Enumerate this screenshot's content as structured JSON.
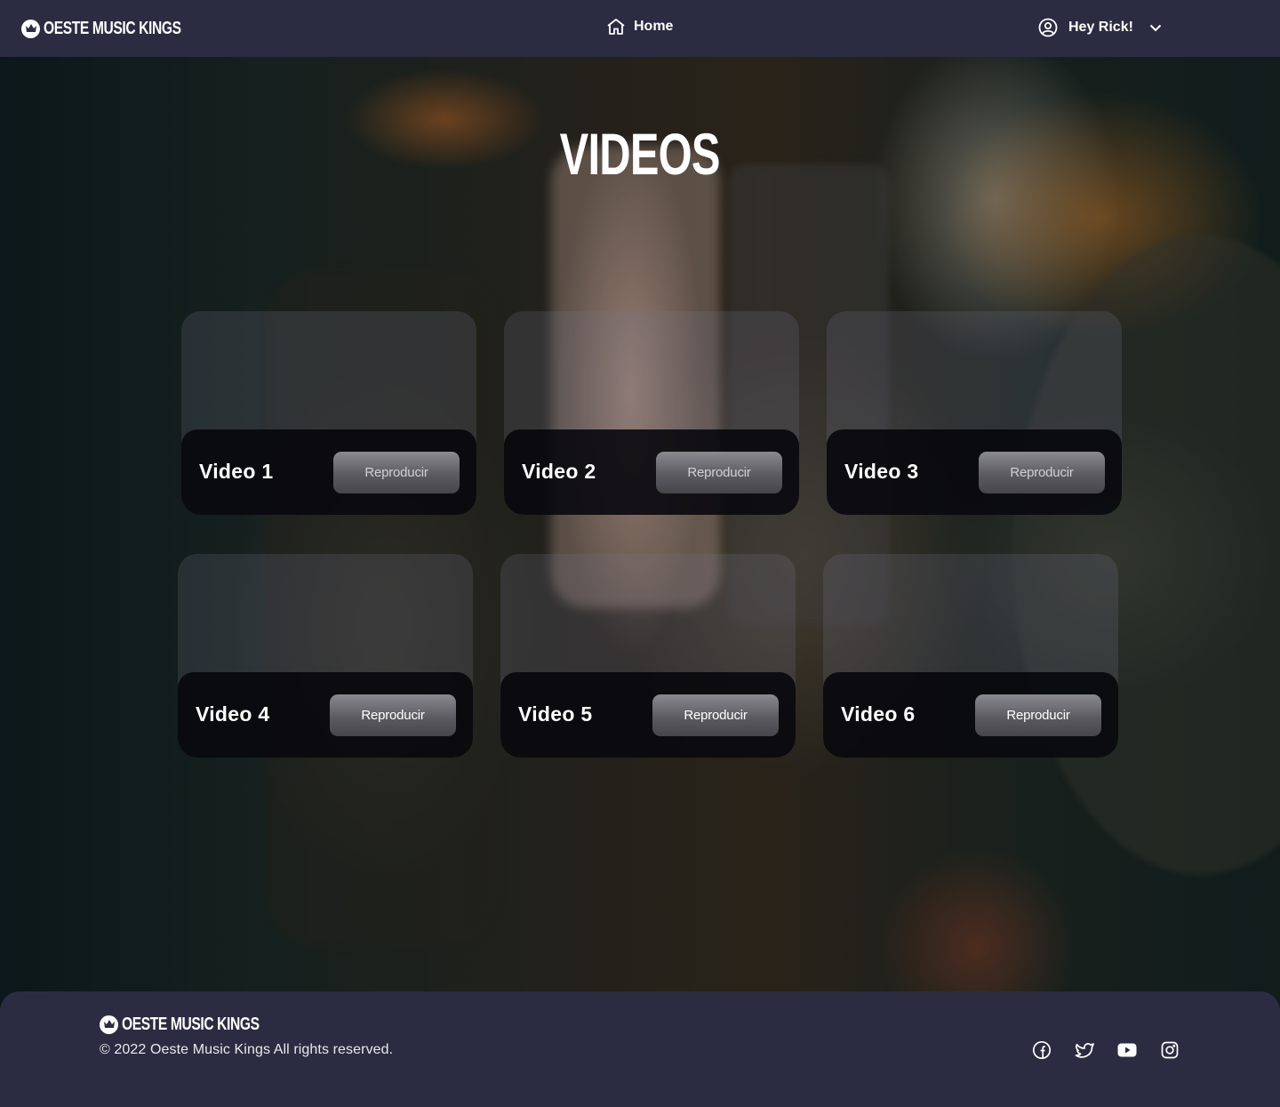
{
  "navbar": {
    "brand": "OESTE MUSIC KINGS",
    "brand_icon": "crown-icon",
    "home_label": "Home",
    "home_icon": "home-icon",
    "user_greeting": "Hey Rick!",
    "user_icon": "user-circle-icon",
    "dropdown_icon": "chevron-down-icon"
  },
  "main": {
    "title": "VIDEOS",
    "videos": [
      {
        "title": "Video 1",
        "button": "Reproducir"
      },
      {
        "title": "Video 2",
        "button": "Reproducir"
      },
      {
        "title": "Video 3",
        "button": "Reproducir"
      },
      {
        "title": "Video 4",
        "button": "Reproducir"
      },
      {
        "title": "Video 5",
        "button": "Reproducir"
      },
      {
        "title": "Video 6",
        "button": "Reproducir"
      }
    ]
  },
  "footer": {
    "brand": "OESTE MUSIC KINGS",
    "copyright": "© 2022 Oeste Music Kings All rights reserved.",
    "social": [
      "facebook-icon",
      "twitter-icon",
      "youtube-icon",
      "instagram-icon"
    ]
  },
  "colors": {
    "nav_bg": "#2b2c41",
    "card_bar": "#06060a",
    "button": "#5b5b61",
    "text": "#ffffff"
  }
}
